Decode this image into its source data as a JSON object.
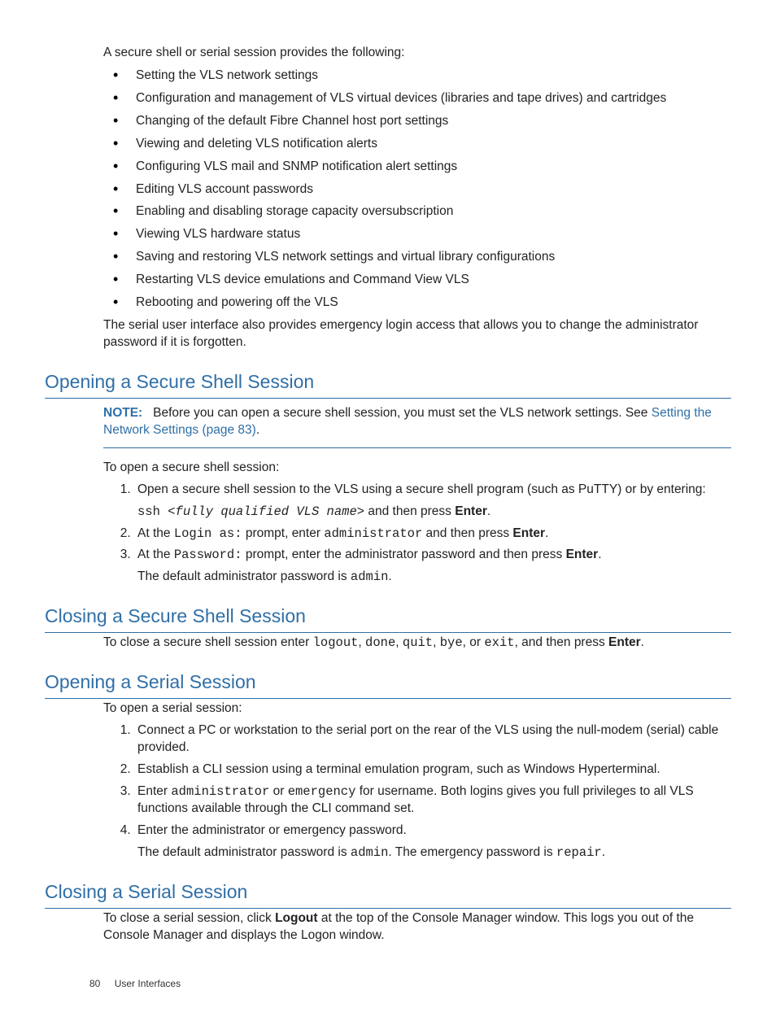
{
  "intro": "A secure shell or serial session provides the following:",
  "bullets": [
    "Setting the VLS network settings",
    "Configuration and management of VLS virtual devices (libraries and tape drives) and cartridges",
    "Changing of the default Fibre Channel host port settings",
    "Viewing and deleting VLS notification alerts",
    "Configuring VLS mail and SNMP notification alert settings",
    "Editing VLS account passwords",
    "Enabling and disabling storage capacity oversubscription",
    "Viewing VLS hardware status",
    "Saving and restoring VLS network settings and virtual library configurations",
    "Restarting VLS device emulations and Command View VLS",
    "Rebooting and powering off the VLS"
  ],
  "intro_tail": "The serial user interface also provides emergency login access that allows you to change the administrator password if it is forgotten.",
  "sec1": {
    "h": "Opening a Secure Shell Session",
    "note_label": "NOTE:",
    "note_body": "Before you can open a secure shell session, you must set the VLS network settings. See ",
    "note_link": "Setting the Network Settings (page 83)",
    "note_tail": ".",
    "lead": "To open a secure shell session:",
    "step1": "Open a secure shell session to the VLS using a secure shell program (such as PuTTY) or by entering:",
    "step1_code_a": "ssh ",
    "step1_code_b": "<fully qualified VLS name>",
    "step1_after": " and then press ",
    "enter": "Enter",
    "step2_a": "At the ",
    "step2_code1": "Login as:",
    "step2_b": " prompt, enter ",
    "step2_code2": "administrator",
    "step2_c": " and then press ",
    "step3_a": "At the ",
    "step3_code1": "Password:",
    "step3_b": " prompt, enter the administrator password and then press ",
    "step3_tail": "The default administrator password is ",
    "step3_admin": "admin",
    "period": "."
  },
  "sec2": {
    "h": "Closing a Secure Shell Session",
    "body_a": "To close a secure shell session enter ",
    "c1": "logout",
    "c2": "done",
    "c3": "quit",
    "c4": "bye",
    "c5": "exit",
    "sep": ", ",
    "or": ", or ",
    "body_b": ", and then press ",
    "enter": "Enter",
    "period": "."
  },
  "sec3": {
    "h": "Opening a Serial Session",
    "lead": "To open a serial session:",
    "step1": "Connect a PC or workstation to the serial port on the rear of the VLS using the null-modem (serial) cable provided.",
    "step2": "Establish a CLI session using a terminal emulation program, such as Windows Hyperterminal.",
    "step3_a": "Enter ",
    "step3_c1": "administrator",
    "step3_b": " or ",
    "step3_c2": "emergency",
    "step3_c": " for username. Both logins gives you full privileges to all VLS functions available through the CLI command set.",
    "step4": "Enter the administrator or emergency password.",
    "step4b_a": "The default administrator password is ",
    "step4b_c1": "admin",
    "step4b_b": ". The emergency password is ",
    "step4b_c2": "repair",
    "period": "."
  },
  "sec4": {
    "h": "Closing a Serial Session",
    "body_a": "To close a serial session, click ",
    "logout": "Logout",
    "body_b": " at the top of the Console Manager window. This logs you out of the Console Manager and displays the Logon window."
  },
  "footer": {
    "page": "80",
    "title": "User Interfaces"
  }
}
